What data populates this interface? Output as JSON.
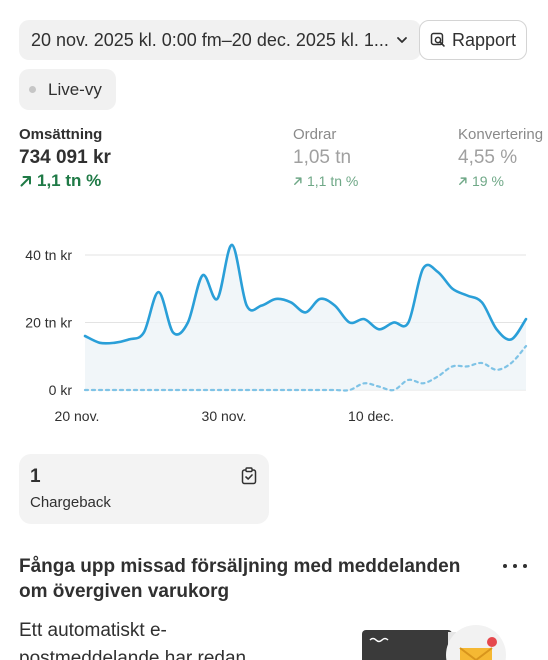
{
  "toolbar": {
    "date_range": "20 nov. 2025 kl. 0:00 fm–20 dec. 2025 kl. 1...",
    "report_label": "Rapport",
    "live_label": "Live-vy"
  },
  "metrics": [
    {
      "label": "Omsättning",
      "value": "734 091 kr",
      "delta": "1,1 tn %"
    },
    {
      "label": "Ordrar",
      "value": "1,05 tn",
      "delta": "1,1 tn %"
    },
    {
      "label": "Konvertering",
      "value": "4,55 %",
      "delta": "19 %"
    }
  ],
  "chart_data": {
    "type": "line",
    "y_ticks": [
      "40 tn kr",
      "20 tn kr",
      "0 kr"
    ],
    "x_ticks": [
      "20 nov.",
      "30 nov.",
      "10 dec."
    ],
    "ylim": [
      0,
      40000
    ],
    "series": [
      {
        "style": "solid",
        "color": "#2a9fd8",
        "values": [
          16000,
          14000,
          14000,
          15000,
          17000,
          29000,
          17000,
          20000,
          34000,
          27000,
          43000,
          25000,
          25000,
          27000,
          26000,
          23000,
          27000,
          25000,
          20000,
          21000,
          18000,
          20000,
          20000,
          36000,
          35000,
          30000,
          28000,
          26000,
          18000,
          15000,
          21000
        ]
      },
      {
        "style": "dashed",
        "color": "#7fc3e6",
        "values": [
          0,
          0,
          0,
          0,
          0,
          0,
          0,
          0,
          0,
          0,
          0,
          0,
          0,
          0,
          0,
          0,
          0,
          0,
          0,
          2000,
          1000,
          0,
          3000,
          2000,
          4000,
          7000,
          7000,
          8000,
          6000,
          8000,
          13000
        ]
      }
    ]
  },
  "chargeback": {
    "count": "1",
    "label": "Chargeback"
  },
  "promo": {
    "title": "Fånga upp missad försäljning med meddelanden om övergiven varukorg",
    "body": "Ett automatiskt e-postmeddelande har redan"
  },
  "colors": {
    "accent_line": "#2a9fd8",
    "positive": "#1f7a46"
  }
}
